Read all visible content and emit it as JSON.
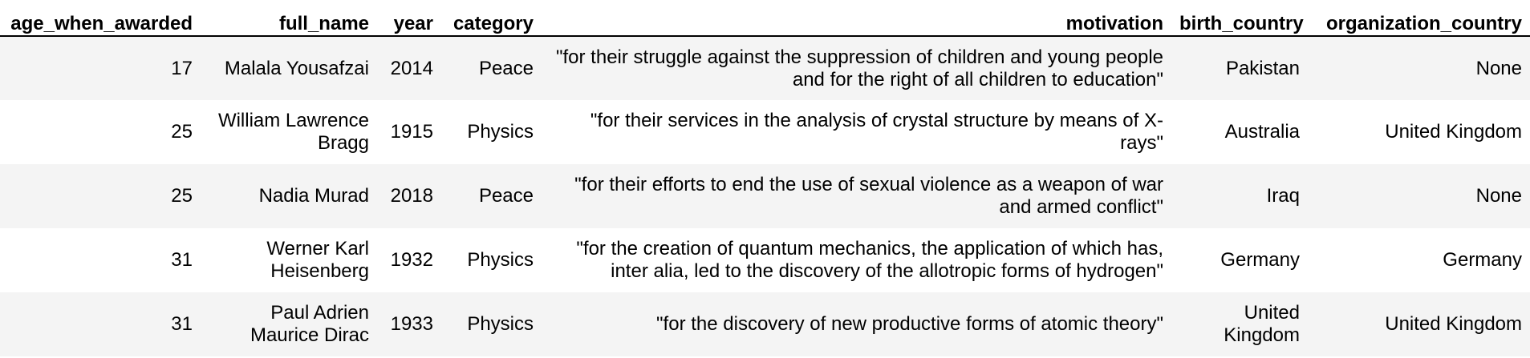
{
  "table": {
    "columns": [
      "age_when_awarded",
      "full_name",
      "year",
      "category",
      "motivation",
      "birth_country",
      "organization_country"
    ],
    "rows": [
      {
        "age_when_awarded": "17",
        "full_name": "Malala Yousafzai",
        "year": "2014",
        "category": "Peace",
        "motivation": "\"for their struggle against the suppression of children and young people and for the right of all children to education\"",
        "birth_country": "Pakistan",
        "organization_country": "None"
      },
      {
        "age_when_awarded": "25",
        "full_name": "William Lawrence Bragg",
        "year": "1915",
        "category": "Physics",
        "motivation": "\"for their services in the analysis of crystal structure by means of X-rays\"",
        "birth_country": "Australia",
        "organization_country": "United Kingdom"
      },
      {
        "age_when_awarded": "25",
        "full_name": "Nadia Murad",
        "year": "2018",
        "category": "Peace",
        "motivation": "\"for their efforts to end the use of sexual violence as a weapon of war and armed conflict\"",
        "birth_country": "Iraq",
        "organization_country": "None"
      },
      {
        "age_when_awarded": "31",
        "full_name": "Werner Karl Heisenberg",
        "year": "1932",
        "category": "Physics",
        "motivation": "\"for the creation of quantum mechanics, the application of which has, inter alia, led to the discovery of the allotropic forms of hydrogen\"",
        "birth_country": "Germany",
        "organization_country": "Germany"
      },
      {
        "age_when_awarded": "31",
        "full_name": "Paul Adrien Maurice Dirac",
        "year": "1933",
        "category": "Physics",
        "motivation": "\"for the discovery of new productive forms of atomic theory\"",
        "birth_country": "United Kingdom",
        "organization_country": "United Kingdom"
      }
    ]
  }
}
